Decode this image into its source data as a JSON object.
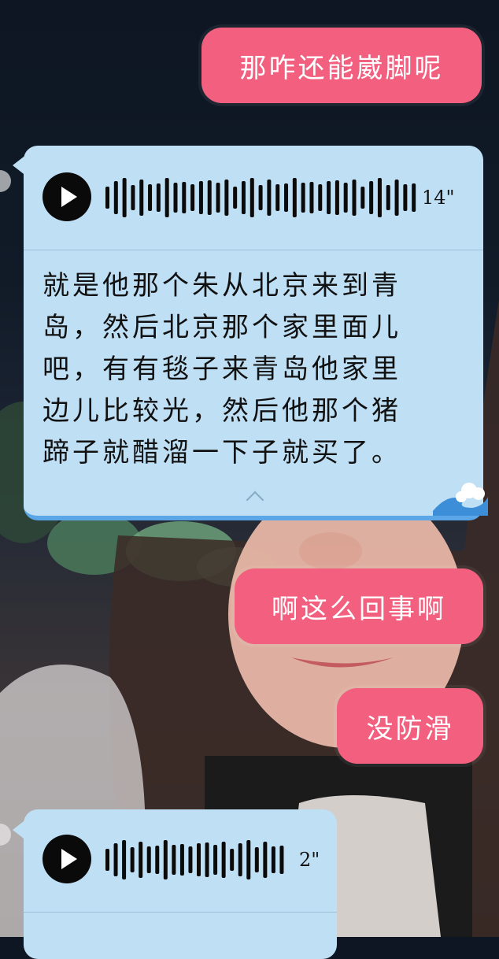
{
  "messages": {
    "m1": {
      "text": "那咋还能崴脚呢"
    },
    "voice1": {
      "duration": "14\"",
      "transcript": "就是他那个朱从北京来到青\n岛，然后北京那个家里面儿\n吧，有有毯子来青岛他家里\n边儿比较光，然后他那个猪\n蹄子就醋溜一下子就买了。"
    },
    "m2": {
      "text": "啊这么回事啊"
    },
    "m3": {
      "text": "没防滑"
    },
    "voice2": {
      "duration": "2\""
    }
  },
  "colors": {
    "pink_bubble": "#f25f7f",
    "blue_bubble": "#bfdff5",
    "blue_border": "#5aa6e6"
  },
  "icons": [
    "play-icon",
    "waveform-icon",
    "wave-sticker-icon",
    "chevron-up-icon"
  ]
}
